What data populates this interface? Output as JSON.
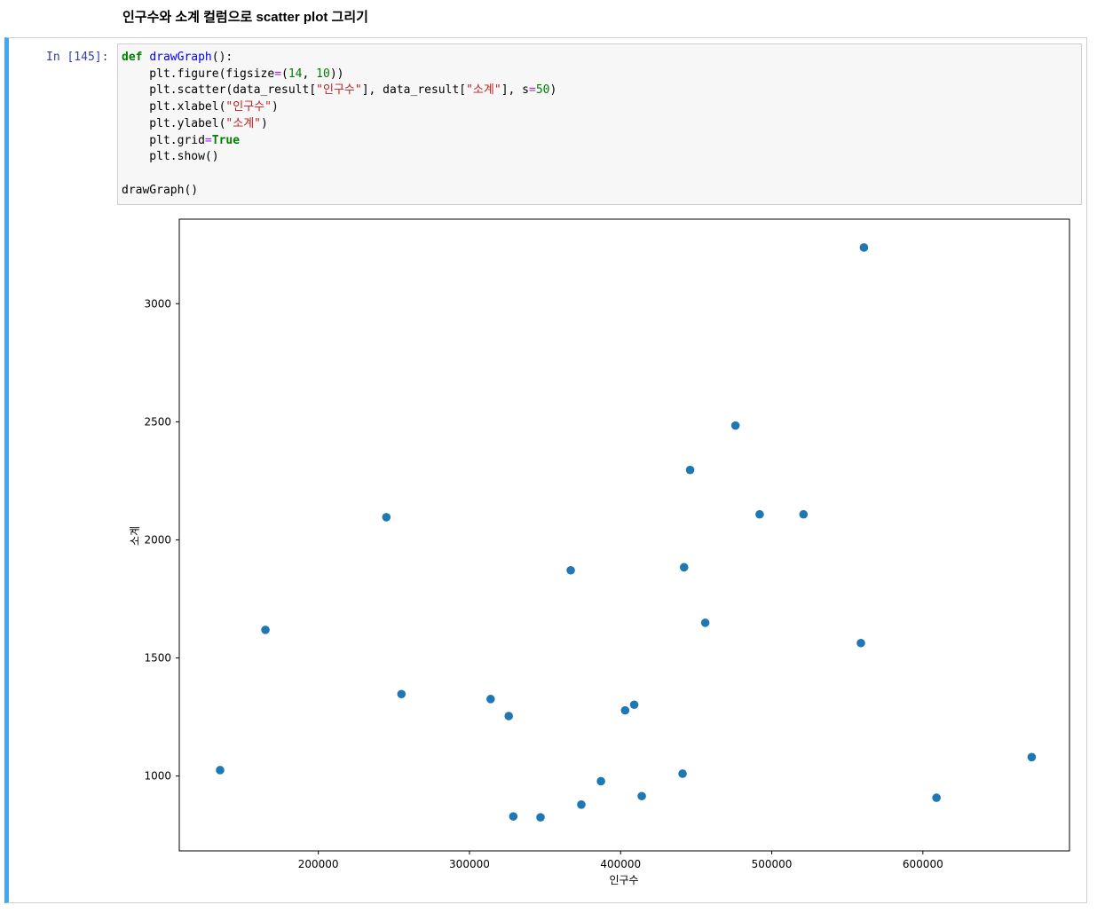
{
  "markdown": {
    "heading": "인구수와 소계 컬럼으로 scatter plot 그리기"
  },
  "cell": {
    "prompt": "In [145]:",
    "code": {
      "def": "def",
      "fn_name": "drawGraph",
      "sig_rest": "():",
      "l2_a": "    plt.figure(figsize",
      "l2_eq": "=",
      "l2_b": "(",
      "l2_n1": "14",
      "l2_c": ", ",
      "l2_n2": "10",
      "l2_d": "))",
      "l3_a": "    plt.scatter(data_result[",
      "l3_s1": "\"인구수\"",
      "l3_b": "], data_result[",
      "l3_s2": "\"소계\"",
      "l3_c": "], s",
      "l3_eq": "=",
      "l3_n": "50",
      "l3_d": ")",
      "l4_a": "    plt.xlabel(",
      "l4_s": "\"인구수\"",
      "l4_b": ")",
      "l5_a": "    plt.ylabel(",
      "l5_s": "\"소계\"",
      "l5_b": ")",
      "l6_a": "    plt.grid",
      "l6_eq": "=",
      "l6_kw": "True",
      "l7": "    plt.show()",
      "l9": "drawGraph()"
    }
  },
  "chart_data": {
    "type": "scatter",
    "title": "",
    "xlabel": "인구수",
    "ylabel": "소계",
    "xlim": [
      108000,
      697000
    ],
    "ylim": [
      683000,
      3358000
    ],
    "xticks": [
      200000,
      300000,
      400000,
      500000,
      600000
    ],
    "xtick_labels": [
      "200000",
      "300000",
      "400000",
      "500000",
      "600000"
    ],
    "yticks": [
      1000,
      1500,
      2000,
      2500,
      3000
    ],
    "ytick_labels": [
      "1000",
      "1500",
      "2000",
      "2500",
      "3000"
    ],
    "grid": false,
    "color": "#1f77b4",
    "points": [
      {
        "x": 561000,
        "y": 3238
      },
      {
        "x": 476000,
        "y": 2484
      },
      {
        "x": 446000,
        "y": 2296
      },
      {
        "x": 492000,
        "y": 2108
      },
      {
        "x": 521000,
        "y": 2108
      },
      {
        "x": 245000,
        "y": 2096
      },
      {
        "x": 442000,
        "y": 1884
      },
      {
        "x": 367000,
        "y": 1871
      },
      {
        "x": 456000,
        "y": 1649
      },
      {
        "x": 165000,
        "y": 1619
      },
      {
        "x": 559000,
        "y": 1563
      },
      {
        "x": 255000,
        "y": 1347
      },
      {
        "x": 314000,
        "y": 1326
      },
      {
        "x": 409000,
        "y": 1302
      },
      {
        "x": 403000,
        "y": 1278
      },
      {
        "x": 326000,
        "y": 1254
      },
      {
        "x": 672000,
        "y": 1080
      },
      {
        "x": 135000,
        "y": 1025
      },
      {
        "x": 441000,
        "y": 1010
      },
      {
        "x": 387000,
        "y": 978
      },
      {
        "x": 414000,
        "y": 915
      },
      {
        "x": 609000,
        "y": 908
      },
      {
        "x": 374000,
        "y": 879
      },
      {
        "x": 329000,
        "y": 829
      },
      {
        "x": 347000,
        "y": 825
      }
    ]
  }
}
